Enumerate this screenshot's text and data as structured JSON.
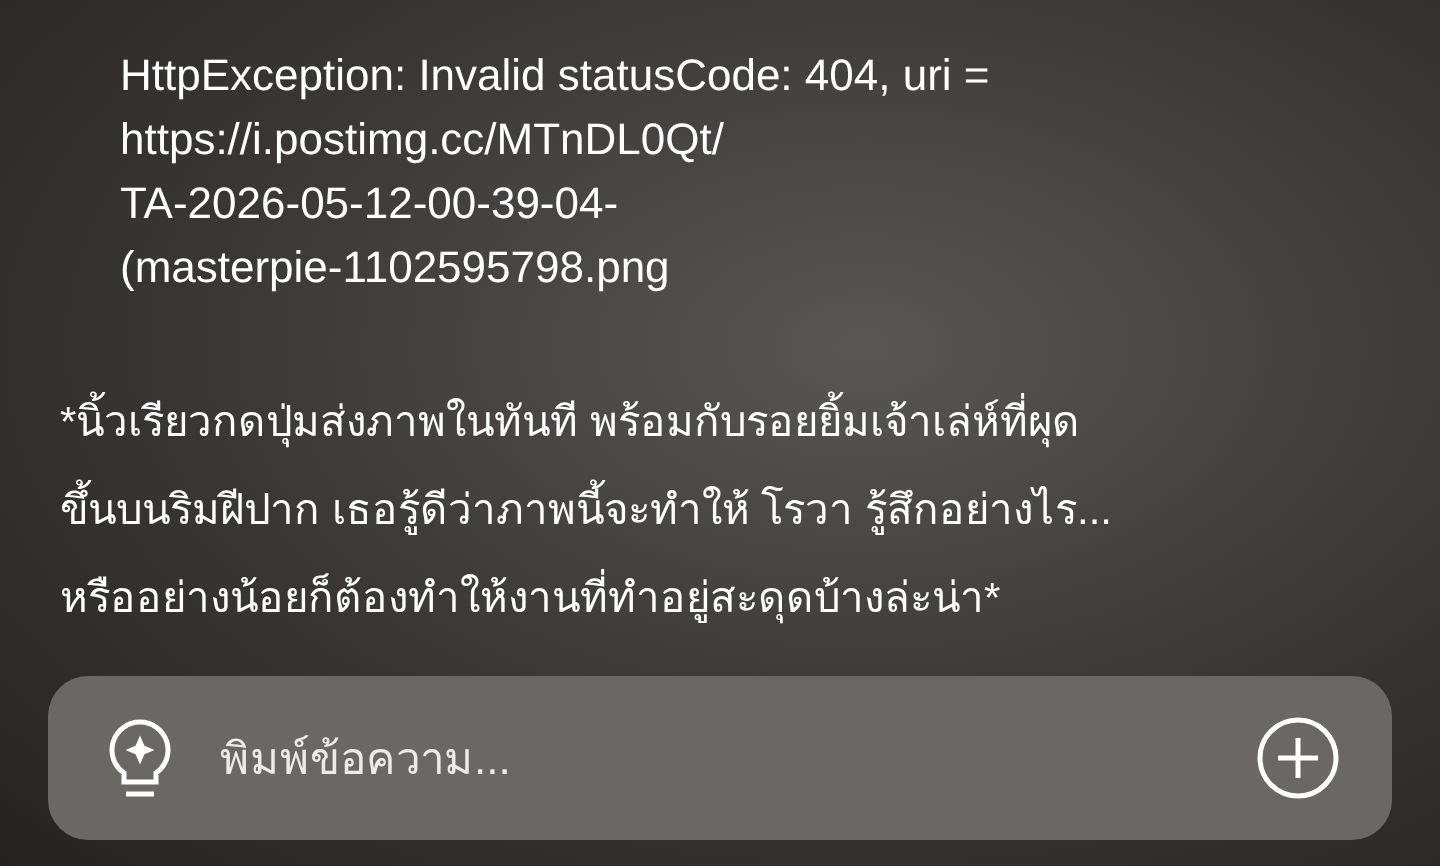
{
  "error_message": {
    "lines": [
      "HttpException: Invalid statusCode: 404, uri =",
      "https://i.postimg.cc/MTnDL0Qt/",
      "TA-2026-05-12-00-39-04-",
      "(masterpie-1102595798.png"
    ]
  },
  "narration": {
    "lines": [
      "*นิ้วเรียวกดปุ่มส่งภาพในทันที พร้อมกับรอยยิ้มเจ้าเล่ห์ที่ผุด",
      "ขึ้นบนริมฝีปาก เธอรู้ดีว่าภาพนี้จะทำให้ โรวา รู้สึกอย่างไร...",
      "หรืออย่างน้อยก็ต้องทำให้งานที่ทำอยู่สะดุดบ้างล่ะน่า*"
    ]
  },
  "composer": {
    "placeholder": "พิมพ์ข้อความ..."
  }
}
